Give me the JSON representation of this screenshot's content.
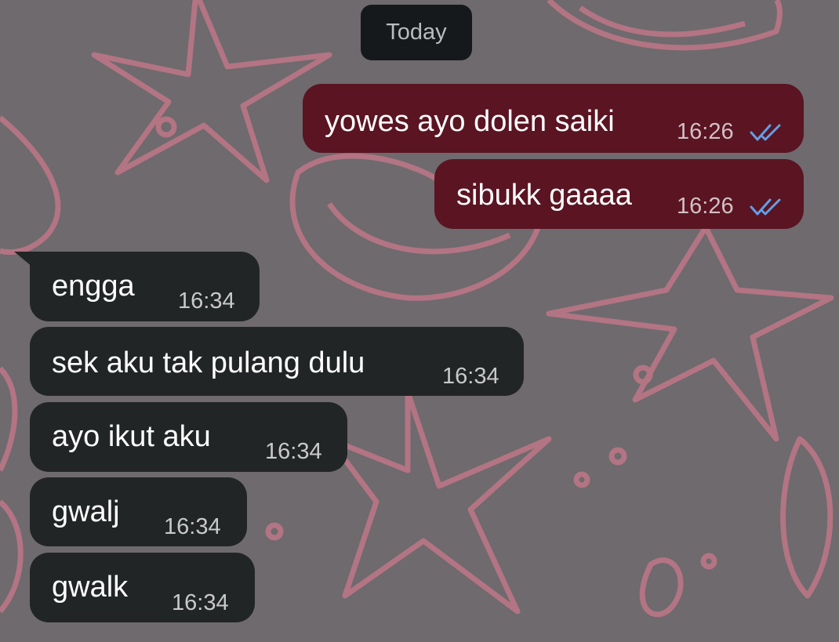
{
  "chat": {
    "date_separator": "Today",
    "colors": {
      "background": "#6e6a6d",
      "pattern": "#c8778a",
      "outgoing_bubble": "#5a1422",
      "incoming_bubble": "#222526",
      "read_ticks": "#5fa0e8"
    },
    "outgoing": [
      {
        "text": "yowes ayo dolen saiki",
        "time": "16:26",
        "status": "read"
      },
      {
        "text": "sibukk gaaaa",
        "time": "16:26",
        "status": "read"
      }
    ],
    "incoming": [
      {
        "text": "engga",
        "time": "16:34"
      },
      {
        "text": "sek aku tak pulang dulu",
        "time": "16:34"
      },
      {
        "text": "ayo ikut aku",
        "time": "16:34"
      },
      {
        "text": "gwalj",
        "time": "16:34"
      },
      {
        "text": "gwalk",
        "time": "16:34"
      }
    ],
    "icons": {
      "read_receipt": "double-check-icon"
    }
  }
}
